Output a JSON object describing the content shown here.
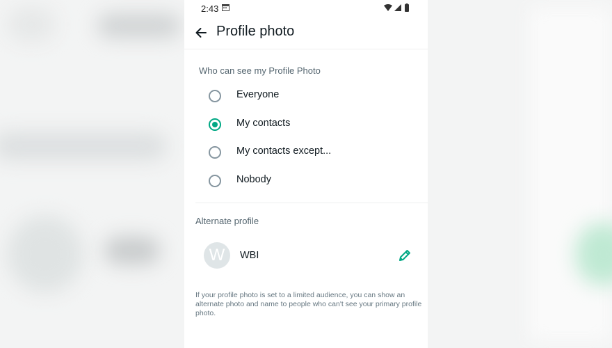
{
  "status_bar": {
    "time": "2:43"
  },
  "header": {
    "title": "Profile photo"
  },
  "visibility": {
    "heading": "Who can see my Profile Photo",
    "options": [
      {
        "label": "Everyone",
        "selected": false
      },
      {
        "label": "My contacts",
        "selected": true
      },
      {
        "label": "My contacts except...",
        "selected": false
      },
      {
        "label": "Nobody",
        "selected": false
      }
    ]
  },
  "alternate": {
    "heading": "Alternate profile",
    "avatar_letter": "W",
    "name": "WBI"
  },
  "footnote": "If your profile photo is set to a limited audience, you can show an alternate photo and name to people who can't see your primary profile photo.",
  "colors": {
    "accent": "#00a884",
    "radio_unchecked": "#8696a0",
    "secondary_text": "#54656f"
  }
}
